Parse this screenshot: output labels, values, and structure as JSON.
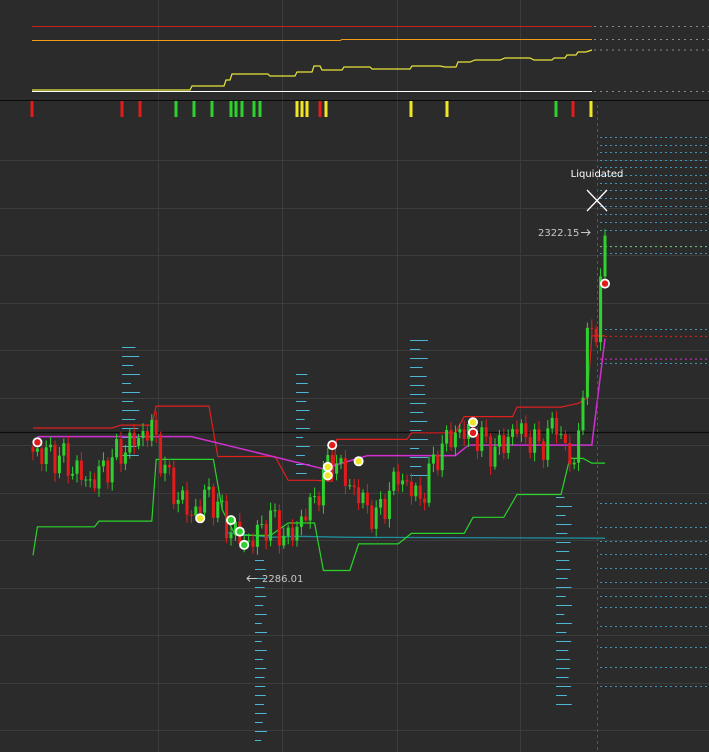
{
  "chart_data": {
    "type": "candlestick",
    "annotations": {
      "liquidated_label": "Liquidated",
      "high_label": "2322.15",
      "low_label": "2286.01"
    },
    "y_range": [
      2274.5,
      2327.0
    ],
    "colors": {
      "background": "#2b2b2b",
      "grid": "#3c3c3c",
      "up": "#2ed12e",
      "down": "#e21b1b",
      "upper_band": "#e01f1f",
      "lower_band": "#2ad42a",
      "magenta_line": "#d22fd2",
      "teal_line": "#1e8f9c",
      "volume_ticks": "#4fb7d6",
      "signal_yellow": "#f0e628",
      "cursor": "#c0262b"
    },
    "signal_colors": [
      "red",
      "red",
      "red",
      "green",
      "green",
      "green",
      "green",
      "green",
      "green",
      "green",
      "green",
      "yellow",
      "yellow",
      "yellow",
      "red",
      "yellow",
      "yellow",
      "yellow",
      "green",
      "red",
      "yellow"
    ],
    "markers": [
      {
        "bar": 1,
        "price": 2301.5,
        "type": "red"
      },
      {
        "bar": 38,
        "price": 2293.5,
        "type": "yellow"
      },
      {
        "bar": 45,
        "price": 2293.3,
        "type": "green"
      },
      {
        "bar": 47,
        "price": 2292.1,
        "type": "green"
      },
      {
        "bar": 48,
        "price": 2290.7,
        "type": "green"
      },
      {
        "bar": 67,
        "price": 2298.0,
        "type": "yellow"
      },
      {
        "bar": 67,
        "price": 2298.9,
        "type": "yellow"
      },
      {
        "bar": 68,
        "price": 2301.2,
        "type": "red"
      },
      {
        "bar": 74,
        "price": 2299.5,
        "type": "yellow"
      },
      {
        "bar": 100,
        "price": 2303.6,
        "type": "yellow"
      },
      {
        "bar": 100,
        "price": 2302.5,
        "type": "red"
      },
      {
        "bar": 130,
        "price": 2318.2,
        "type": "red"
      }
    ]
  }
}
